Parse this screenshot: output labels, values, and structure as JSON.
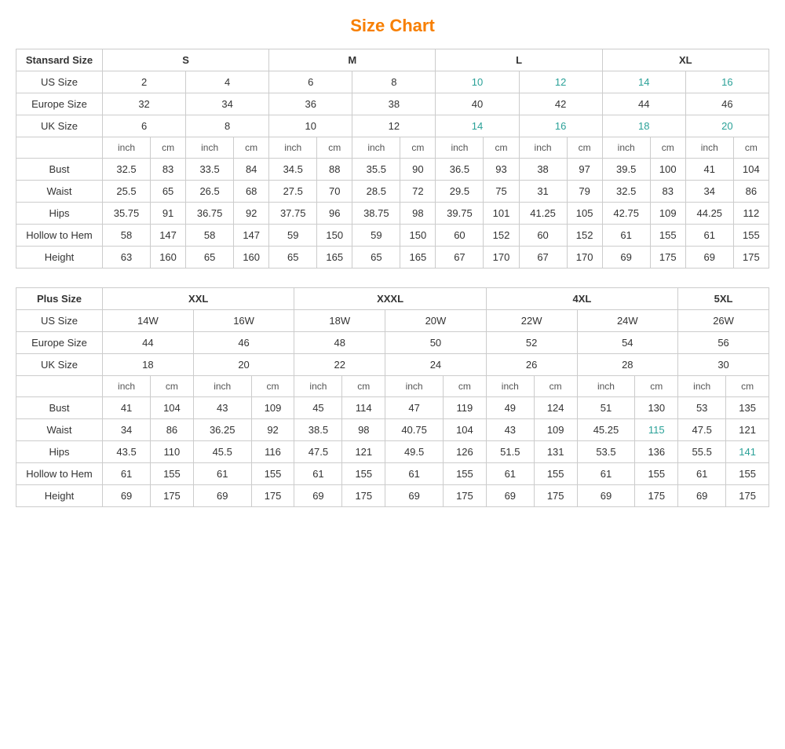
{
  "title": "Size Chart",
  "table1": {
    "headers": {
      "col1": "Stansard Size",
      "s": "S",
      "m": "M",
      "l": "L",
      "xl": "XL"
    },
    "us_size": {
      "label": "US Size",
      "values": [
        "2",
        "4",
        "6",
        "8",
        "10",
        "12",
        "14",
        "16"
      ]
    },
    "europe_size": {
      "label": "Europe Size",
      "values": [
        "32",
        "34",
        "36",
        "38",
        "40",
        "42",
        "44",
        "46"
      ]
    },
    "uk_size": {
      "label": "UK Size",
      "values": [
        "6",
        "8",
        "10",
        "12",
        "14",
        "16",
        "18",
        "20"
      ]
    },
    "units": [
      "inch",
      "cm",
      "inch",
      "cm",
      "inch",
      "cm",
      "inch",
      "cm",
      "inch",
      "cm",
      "inch",
      "cm",
      "inch",
      "cm",
      "inch",
      "cm"
    ],
    "bust": {
      "label": "Bust",
      "values": [
        "32.5",
        "83",
        "33.5",
        "84",
        "34.5",
        "88",
        "35.5",
        "90",
        "36.5",
        "93",
        "38",
        "97",
        "39.5",
        "100",
        "41",
        "104"
      ]
    },
    "waist": {
      "label": "Waist",
      "values": [
        "25.5",
        "65",
        "26.5",
        "68",
        "27.5",
        "70",
        "28.5",
        "72",
        "29.5",
        "75",
        "31",
        "79",
        "32.5",
        "83",
        "34",
        "86"
      ]
    },
    "hips": {
      "label": "Hips",
      "values": [
        "35.75",
        "91",
        "36.75",
        "92",
        "37.75",
        "96",
        "38.75",
        "98",
        "39.75",
        "101",
        "41.25",
        "105",
        "42.75",
        "109",
        "44.25",
        "112"
      ]
    },
    "hollow_to_hem": {
      "label": "Hollow to Hem",
      "values": [
        "58",
        "147",
        "58",
        "147",
        "59",
        "150",
        "59",
        "150",
        "60",
        "152",
        "60",
        "152",
        "61",
        "155",
        "61",
        "155"
      ]
    },
    "height": {
      "label": "Height",
      "values": [
        "63",
        "160",
        "65",
        "160",
        "65",
        "165",
        "65",
        "165",
        "67",
        "170",
        "67",
        "170",
        "69",
        "175",
        "69",
        "175"
      ]
    }
  },
  "table2": {
    "headers": {
      "col1": "Plus Size",
      "xxl": "XXL",
      "xxxl": "XXXL",
      "4xl": "4XL",
      "5xl": "5XL"
    },
    "us_size": {
      "label": "US Size",
      "values": [
        "14W",
        "16W",
        "18W",
        "20W",
        "22W",
        "24W",
        "26W"
      ]
    },
    "europe_size": {
      "label": "Europe Size",
      "values": [
        "44",
        "46",
        "48",
        "50",
        "52",
        "54",
        "56"
      ]
    },
    "uk_size": {
      "label": "UK Size",
      "values": [
        "18",
        "20",
        "22",
        "24",
        "26",
        "28",
        "30"
      ]
    },
    "units": [
      "inch",
      "cm",
      "inch",
      "cm",
      "inch",
      "cm",
      "inch",
      "cm",
      "inch",
      "cm",
      "inch",
      "cm",
      "inch",
      "cm"
    ],
    "bust": {
      "label": "Bust",
      "values": [
        "41",
        "104",
        "43",
        "109",
        "45",
        "114",
        "47",
        "119",
        "49",
        "124",
        "51",
        "130",
        "53",
        "135"
      ]
    },
    "waist": {
      "label": "Waist",
      "values": [
        "34",
        "86",
        "36.25",
        "92",
        "38.5",
        "98",
        "40.75",
        "104",
        "43",
        "109",
        "45.25",
        "115",
        "47.5",
        "121"
      ]
    },
    "hips": {
      "label": "Hips",
      "values": [
        "43.5",
        "110",
        "45.5",
        "116",
        "47.5",
        "121",
        "49.5",
        "126",
        "51.5",
        "131",
        "53.5",
        "136",
        "55.5",
        "141"
      ]
    },
    "hollow_to_hem": {
      "label": "Hollow to Hem",
      "values": [
        "61",
        "155",
        "61",
        "155",
        "61",
        "155",
        "61",
        "155",
        "61",
        "155",
        "61",
        "155",
        "61",
        "155"
      ]
    },
    "height": {
      "label": "Height",
      "values": [
        "69",
        "175",
        "69",
        "175",
        "69",
        "175",
        "69",
        "175",
        "69",
        "175",
        "69",
        "175",
        "69",
        "175"
      ]
    }
  }
}
